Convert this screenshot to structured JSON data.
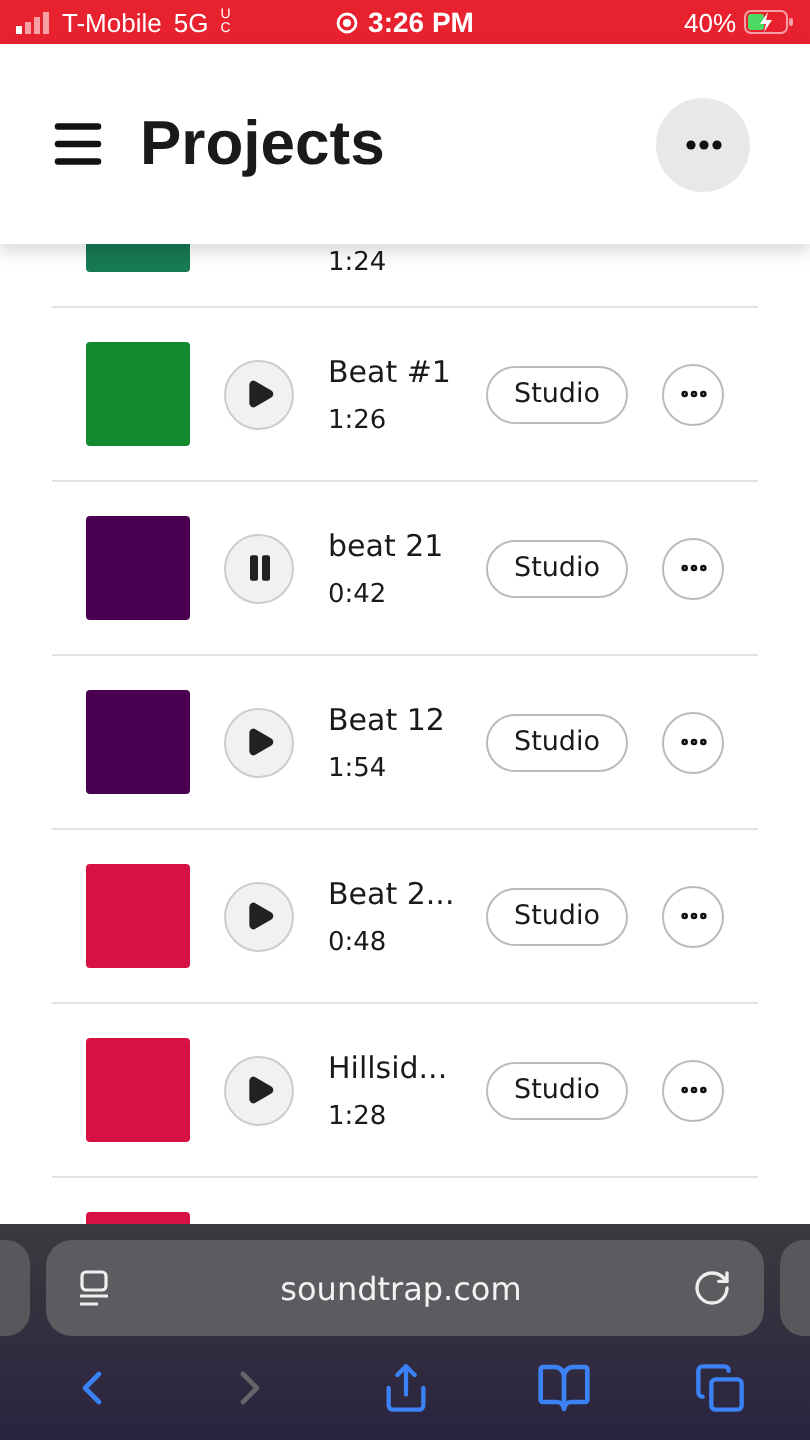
{
  "status_bar": {
    "carrier": "T-Mobile",
    "network": "5G",
    "network_sub": "UC",
    "time": "3:26 PM",
    "battery": "40%"
  },
  "header": {
    "title": "Projects"
  },
  "projects": [
    {
      "duration": "1:24",
      "color": "#177a55"
    },
    {
      "title": "Beat #1",
      "duration": "1:26",
      "color": "#138a2e",
      "playing": false,
      "action": "Studio"
    },
    {
      "title": "beat 21",
      "duration": "0:42",
      "color": "#4a0050",
      "playing": true,
      "action": "Studio"
    },
    {
      "title": "Beat 12",
      "duration": "1:54",
      "color": "#4a0050",
      "playing": false,
      "action": "Studio"
    },
    {
      "title": "Beat 2...",
      "duration": "0:48",
      "color": "#d81145",
      "playing": false,
      "action": "Studio"
    },
    {
      "title": "Hillsid...",
      "duration": "1:28",
      "color": "#d81145",
      "playing": false,
      "action": "Studio"
    },
    {
      "color": "#d81145"
    }
  ],
  "browser": {
    "url": "soundtrap.com",
    "nav": [
      {
        "kind": "back",
        "disabled": false
      },
      {
        "kind": "forward",
        "disabled": true
      },
      {
        "kind": "share",
        "disabled": false
      },
      {
        "kind": "bookmarks",
        "disabled": false
      },
      {
        "kind": "tabs",
        "disabled": false
      }
    ]
  }
}
